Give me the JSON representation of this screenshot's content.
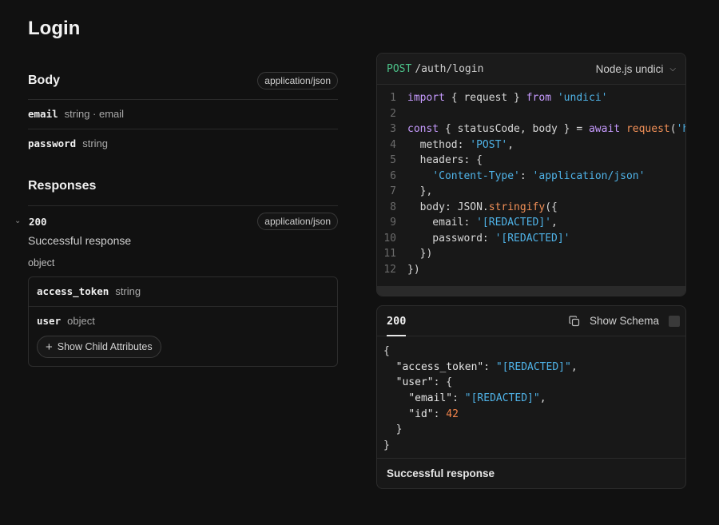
{
  "page": {
    "title": "Login"
  },
  "body_section": {
    "title": "Body",
    "content_type": "application/json",
    "params": [
      {
        "name": "email",
        "type": "string · email"
      },
      {
        "name": "password",
        "type": "string"
      }
    ]
  },
  "responses_section": {
    "title": "Responses",
    "status_code": "200",
    "content_type": "application/json",
    "description": "Successful response",
    "type": "object",
    "attributes": [
      {
        "name": "access_token",
        "type": "string"
      },
      {
        "name": "user",
        "type": "object"
      }
    ],
    "show_child_label": "Show Child Attributes"
  },
  "code_panel": {
    "method": "POST",
    "path": "/auth/login",
    "language": "Node.js undici",
    "lines": [
      [
        [
          "kw",
          "import"
        ],
        [
          "pl",
          " { request } "
        ],
        [
          "kw",
          "from"
        ],
        [
          "pl",
          " "
        ],
        [
          "str",
          "'undici'"
        ]
      ],
      [],
      [
        [
          "kw",
          "const"
        ],
        [
          "pl",
          " { statusCode, body } = "
        ],
        [
          "kw",
          "await"
        ],
        [
          "pl",
          " "
        ],
        [
          "fn",
          "request"
        ],
        [
          "pl",
          "("
        ],
        [
          "str",
          "'https://api.example.com/auth/login'"
        ],
        [
          "pl",
          ", {"
        ]
      ],
      [
        [
          "pl",
          "  method: "
        ],
        [
          "str",
          "'POST'"
        ],
        [
          "pl",
          ","
        ]
      ],
      [
        [
          "pl",
          "  headers: {"
        ]
      ],
      [
        [
          "pl",
          "    "
        ],
        [
          "str",
          "'Content-Type'"
        ],
        [
          "pl",
          ": "
        ],
        [
          "str",
          "'application/json'"
        ]
      ],
      [
        [
          "pl",
          "  },"
        ]
      ],
      [
        [
          "pl",
          "  body: JSON."
        ],
        [
          "fn",
          "stringify"
        ],
        [
          "pl",
          "({"
        ]
      ],
      [
        [
          "pl",
          "    email: "
        ],
        [
          "str",
          "'[REDACTED]'"
        ],
        [
          "pl",
          ","
        ]
      ],
      [
        [
          "pl",
          "    password: "
        ],
        [
          "str",
          "'[REDACTED]'"
        ]
      ],
      [
        [
          "pl",
          "  })"
        ]
      ],
      [
        [
          "pl",
          "})"
        ]
      ]
    ]
  },
  "response_panel": {
    "tab": "200",
    "show_schema_label": "Show Schema",
    "footer": "Successful response",
    "json_lines": [
      [
        [
          "pl",
          "{"
        ]
      ],
      [
        [
          "pl",
          "  "
        ],
        [
          "key",
          "\"access_token\""
        ],
        [
          "pl",
          ": "
        ],
        [
          "str",
          "\"[REDACTED]\""
        ],
        [
          "pl",
          ","
        ]
      ],
      [
        [
          "pl",
          "  "
        ],
        [
          "key",
          "\"user\""
        ],
        [
          "pl",
          ": {"
        ]
      ],
      [
        [
          "pl",
          "    "
        ],
        [
          "key",
          "\"email\""
        ],
        [
          "pl",
          ": "
        ],
        [
          "str",
          "\"[REDACTED]\""
        ],
        [
          "pl",
          ","
        ]
      ],
      [
        [
          "pl",
          "    "
        ],
        [
          "key",
          "\"id\""
        ],
        [
          "pl",
          ": "
        ],
        [
          "num",
          "42"
        ]
      ],
      [
        [
          "pl",
          "  }"
        ]
      ],
      [
        [
          "pl",
          "}"
        ]
      ]
    ]
  }
}
